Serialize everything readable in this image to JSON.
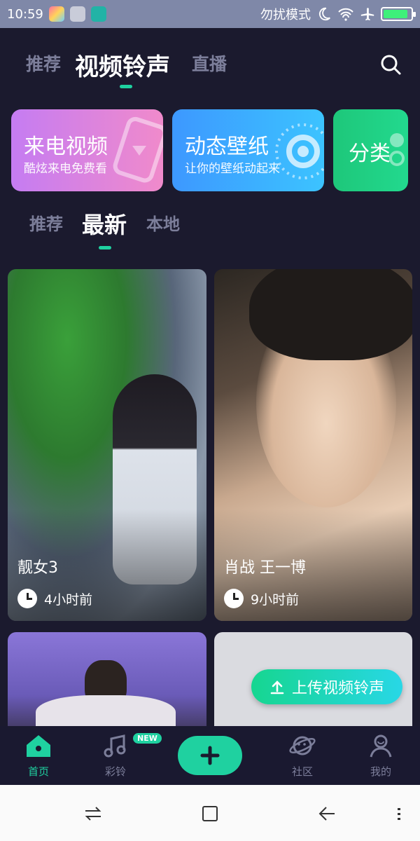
{
  "status_bar": {
    "time": "10:59",
    "dnd_text": "勿扰模式",
    "battery_level": 0.85
  },
  "top_tabs": [
    {
      "label": "推荐",
      "active": false
    },
    {
      "label": "视频铃声",
      "active": true
    },
    {
      "label": "直播",
      "active": false
    }
  ],
  "banners": [
    {
      "title": "来电视频",
      "subtitle": "酷炫来电免费看"
    },
    {
      "title": "动态壁纸",
      "subtitle": "让你的壁纸动起来"
    },
    {
      "title": "分类",
      "subtitle": ""
    }
  ],
  "sub_tabs": [
    {
      "label": "推荐",
      "active": false
    },
    {
      "label": "最新",
      "active": true
    },
    {
      "label": "本地",
      "active": false
    }
  ],
  "feed": [
    {
      "title": "靓女3",
      "time": "4小时前"
    },
    {
      "title": "肖战 王一博",
      "time": "9小时前"
    },
    {
      "title": "",
      "time": ""
    },
    {
      "title": "",
      "time": ""
    }
  ],
  "upload_button": {
    "label": "上传视频铃声"
  },
  "bottom_nav": [
    {
      "label": "首页",
      "icon": "home-icon",
      "active": true
    },
    {
      "label": "彩铃",
      "icon": "music-icon",
      "active": false,
      "badge": "NEW"
    },
    {
      "label": "",
      "icon": "plus-icon",
      "active": false
    },
    {
      "label": "社区",
      "icon": "planet-icon",
      "active": false
    },
    {
      "label": "我的",
      "icon": "profile-icon",
      "active": false
    }
  ],
  "colors": {
    "accent": "#1fd1a0",
    "background": "#1b1a2e",
    "status_bar": "#7f88a8"
  }
}
